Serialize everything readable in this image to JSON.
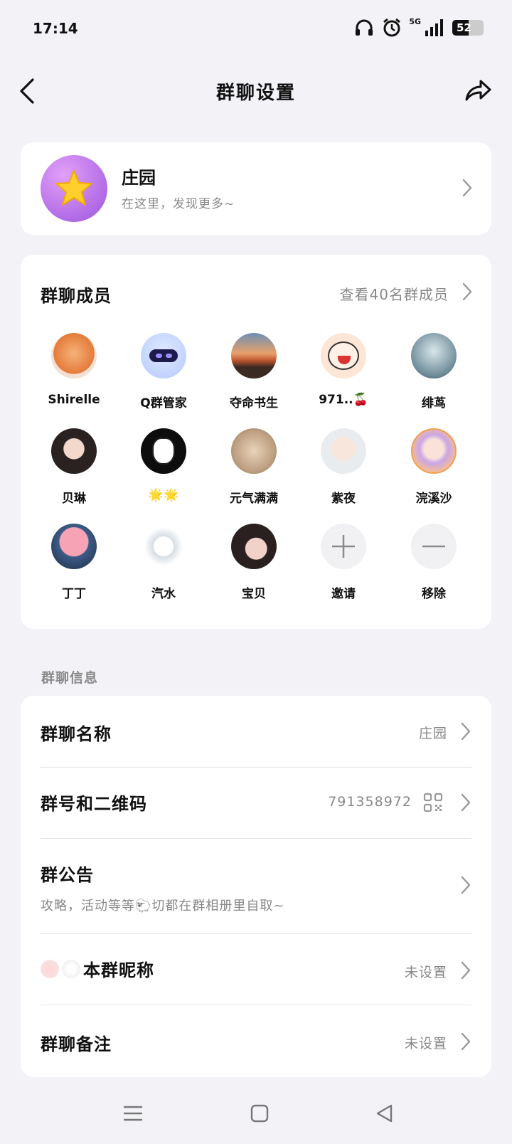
{
  "status": {
    "time": "17:14",
    "network": "5G",
    "battery": "52",
    "battery_level": 0.52
  },
  "nav": {
    "title": "群聊设置"
  },
  "group": {
    "name": "庄园",
    "description": "在这里，发现更多~"
  },
  "members": {
    "title": "群聊成员",
    "view_all": "查看40名群成员",
    "list": [
      {
        "name": "Shirelle"
      },
      {
        "name": "Q群管家"
      },
      {
        "name": "夺命书生"
      },
      {
        "name": "971..🍒"
      },
      {
        "name": "绯茑"
      },
      {
        "name": "贝琳"
      },
      {
        "name": "🌟🌟"
      },
      {
        "name": "元气满满"
      },
      {
        "name": "紫夜"
      },
      {
        "name": "浣溪沙"
      },
      {
        "name": "丁丁"
      },
      {
        "name": "汽水"
      },
      {
        "name": "宝贝"
      }
    ],
    "invite_label": "邀请",
    "remove_label": "移除"
  },
  "info": {
    "section_label": "群聊信息",
    "group_name_label": "群聊名称",
    "group_name_value": "庄园",
    "group_number_label": "群号和二维码",
    "group_number_value": "791358972",
    "announcement_label": "群公告",
    "announcement_text": "攻略，活动等等🐑切都在群相册里自取~",
    "nickname_label": "本群昵称",
    "nickname_value": "未设置",
    "remark_label": "群聊备注",
    "remark_value": "未设置"
  }
}
